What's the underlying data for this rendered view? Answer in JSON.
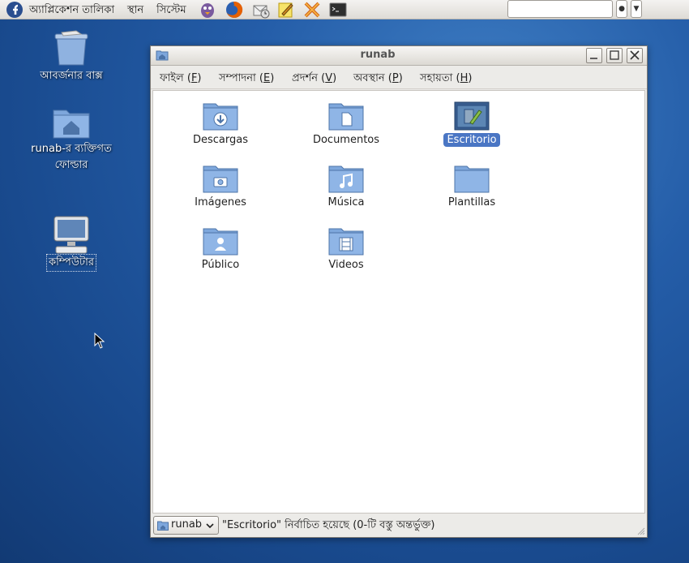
{
  "panel": {
    "menus": [
      "অ্যাপ্লিকেশন তালিকা",
      "স্থান",
      "সিস্টেম"
    ],
    "launchers": [
      "pidgin-icon",
      "firefox-icon",
      "mail-icon",
      "notes-icon",
      "tools-icon",
      "terminal-icon"
    ],
    "search_value": ""
  },
  "desktop": {
    "trash_label": "আবর্জনার বাক্স",
    "home_label_line1": "runab-র ব্যক্তিগত",
    "home_label_line2": "ফোল্ডার",
    "computer_label": "কম্পিউটার"
  },
  "window": {
    "title": "runab",
    "menus": [
      {
        "label": "ফাইল (",
        "key": "F",
        "tail": ")"
      },
      {
        "label": "সম্পাদনা (",
        "key": "E",
        "tail": ")"
      },
      {
        "label": "প্রদর্শন (",
        "key": "V",
        "tail": ")"
      },
      {
        "label": "অবস্থান (",
        "key": "P",
        "tail": ")"
      },
      {
        "label": "সহায়তা (",
        "key": "H",
        "tail": ")"
      }
    ],
    "folders": [
      {
        "label": "Descargas",
        "emblem": "download"
      },
      {
        "label": "Documentos",
        "emblem": "document"
      },
      {
        "label": "Escritorio",
        "emblem": "desktop",
        "selected": true
      },
      {
        "label": "Imágenes",
        "emblem": "camera"
      },
      {
        "label": "Música",
        "emblem": "music"
      },
      {
        "label": "Plantillas",
        "emblem": "none"
      },
      {
        "label": "Público",
        "emblem": "person"
      },
      {
        "label": "Videos",
        "emblem": "film"
      }
    ],
    "status": {
      "path_label": "runab",
      "message": "\"Escritorio\" নির্বাচিত হয়েছে (0-টি বস্তু অন্তর্ভুক্ত)"
    }
  },
  "colors": {
    "selection": "#4a76c4",
    "folder": "#7ea7dc",
    "desktop": "#245da8"
  }
}
